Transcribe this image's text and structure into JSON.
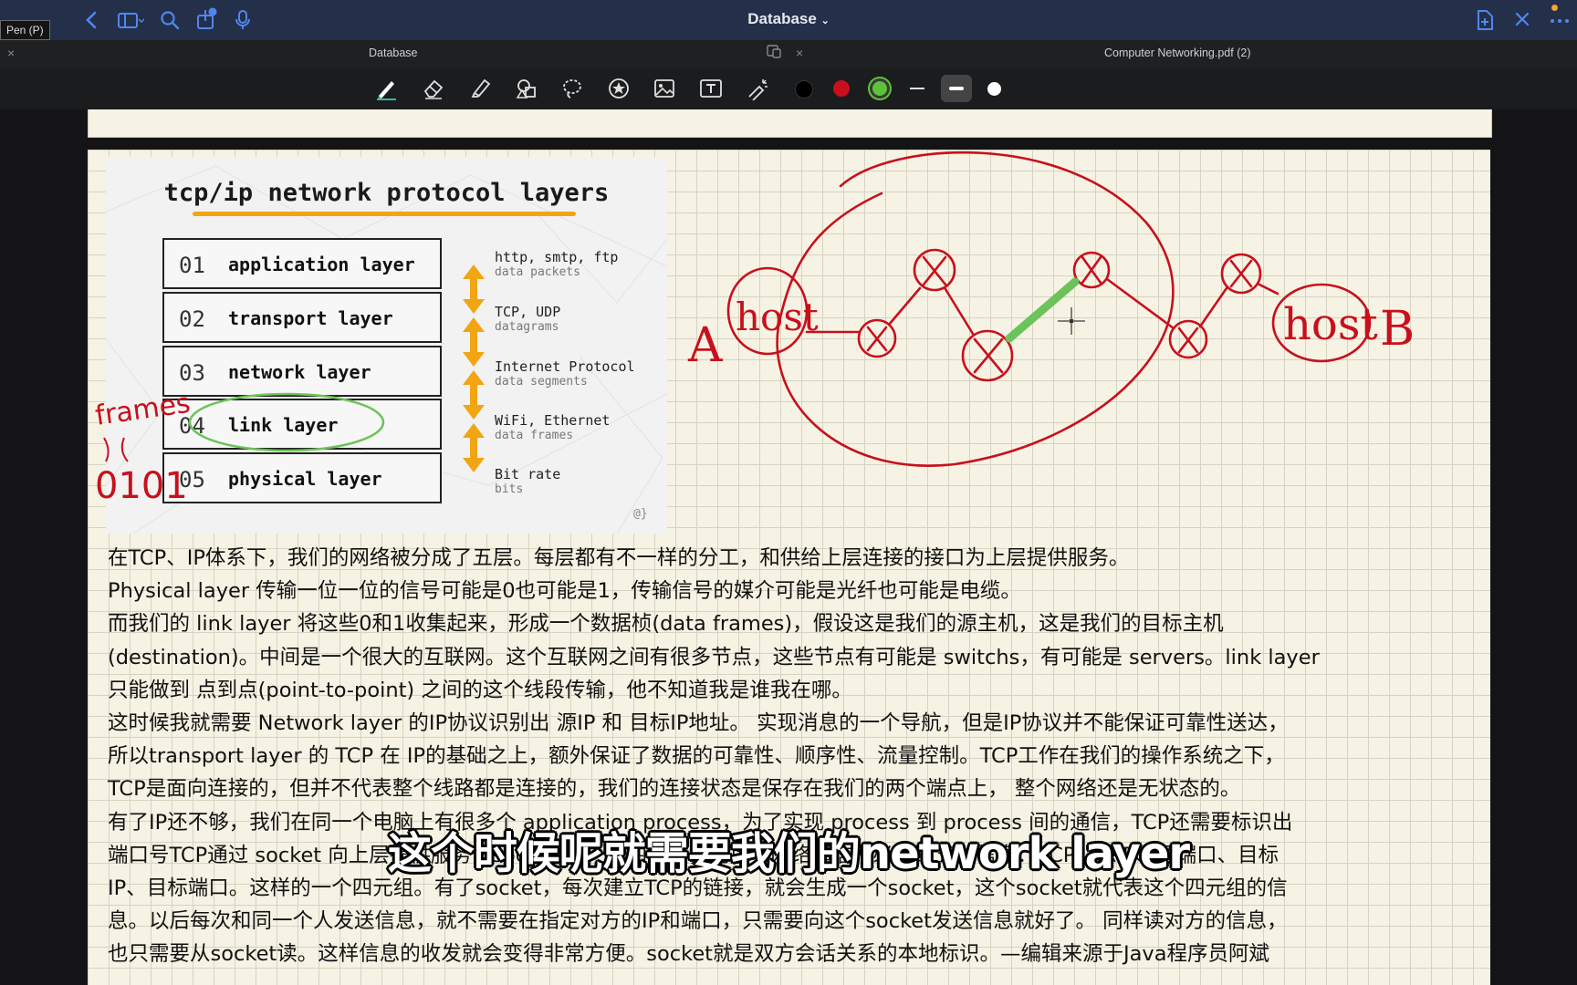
{
  "window": {
    "title": "Database",
    "tooltip": "Pen (P)"
  },
  "tabs": [
    {
      "label": "Database"
    },
    {
      "label": "Computer Networking.pdf (2)"
    }
  ],
  "toolbar": {
    "tools": [
      "pen-icon",
      "eraser-icon",
      "highlighter-icon",
      "shapes-icon",
      "lasso-icon",
      "sticker-icon",
      "image-icon",
      "text-box-icon",
      "laser-pointer-icon"
    ],
    "colors": [
      "#000000",
      "#cc1020",
      "#5cc43a"
    ],
    "sizes": [
      "thin",
      "medium",
      "thick"
    ],
    "selected_tool": "pen",
    "selected_color": "#5cc43a",
    "selected_size": "medium"
  },
  "slide": {
    "title": "tcp/ip network protocol layers",
    "layers": [
      {
        "num": "01",
        "name": "application layer",
        "protocols": "http, smtp, ftp",
        "unit": "data packets"
      },
      {
        "num": "02",
        "name": "transport layer",
        "protocols": "TCP, UDP",
        "unit": "datagrams"
      },
      {
        "num": "03",
        "name": "network layer",
        "protocols": "Internet Protocol",
        "unit": "data segments"
      },
      {
        "num": "04",
        "name": "link layer",
        "protocols": "WiFi, Ethernet",
        "unit": "data frames"
      },
      {
        "num": "05",
        "name": "physical layer",
        "protocols": "Bit rate",
        "unit": "bits"
      }
    ],
    "mark": "@}"
  },
  "handwriting": {
    "frames": "frames",
    "bits": "0101",
    "host_a": "A",
    "host_a_label": "host",
    "host_b": "B",
    "host_b_label": "host"
  },
  "notes": [
    "在TCP、IP体系下，我们的网络被分成了五层。每层都有不一样的分工，和供给上层连接的接口为上层提供服务。",
    "Physical layer 传输一位一位的信号可能是0也可能是1，传输信号的媒介可能是光纤也可能是电缆。",
    "而我们的 link layer 将这些0和1收集起来，形成一个数据桢(data frames)，假设这是我们的源主机，这是我们的目标主机",
    "(destination)。中间是一个很大的互联网。这个互联网之间有很多节点，这些节点有可能是 switchs，有可能是 servers。link layer",
    "只能做到 点到点(point-to-point) 之间的这个线段传输，他不知道我是谁我在哪。",
    "这时候我就需要 Network layer 的IP协议识别出 源IP 和 目标IP地址。 实现消息的一个导航，但是IP协议并不能保证可靠性送达，",
    "所以transport layer 的 TCP 在 IP的基础之上，额外保证了数据的可靠性、顺序性、流量控制。TCP工作在我们的操作系统之下，",
    "TCP是面向连接的，但并不代表整个线路都是连接的，我们的连接状态是保存在我们的两个端点上， 整个网络还是无状态的。",
    "有了IP还不够，我们在同一个电脑上有很多个 application process，为了实现 process 到 process 间的通信，TCP还需要标识出",
    "端口号TCP通过 socket 向上层提供服务，socket 是一个四元组，包括了网络通信所必须的五种信息：TCP、源IP、源端口、目标",
    "IP、目标端口。这样的一个四元组。有了socket，每次建立TCP的链接，就会生成一个socket，这个socket就代表这个四元组的信",
    "息。以后每次和同一个人发送信息，就不需要在指定对方的IP和端口，只需要向这个socket发送信息就好了。 同样读对方的信息，",
    "也只需要从socket读。这样信息的收发就会变得非常方便。socket就是双方会话关系的本地标识。—编辑来源于Java程序员阿斌"
  ],
  "subtitle": "这个时候呢就需要我们的network layer"
}
